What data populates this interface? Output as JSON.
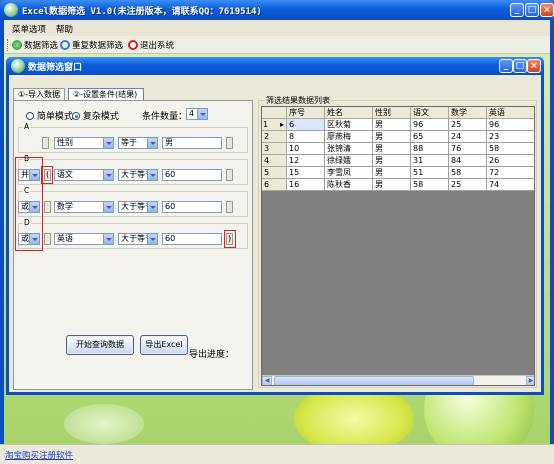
{
  "window": {
    "title": "Excel数据筛选 V1.0(未注册版本，请联系QQ：7619514)",
    "min": "_",
    "max": "□",
    "close": "×"
  },
  "menu": {
    "items": [
      "菜单选项",
      "帮助"
    ]
  },
  "toolbar": {
    "items": [
      "数据筛选",
      "重复数据筛选",
      "退出系统"
    ]
  },
  "inner": {
    "title": "数据筛选窗口",
    "min": "_",
    "max": "□",
    "close": "×"
  },
  "tabs": [
    "①-导入数据",
    "②-设置条件(结果)"
  ],
  "mode": {
    "simple": "简单模式",
    "complex": "复杂模式",
    "selected": "complex",
    "count_label": "条件数量：",
    "count_value": "4"
  },
  "conditions": [
    {
      "group": "A",
      "logic": "",
      "open_paren": "",
      "field": "性别",
      "op": "等于",
      "value": "男",
      "close_paren": ""
    },
    {
      "group": "B",
      "logic": "并",
      "open_paren": "(",
      "field": "语文",
      "op": "大于等于",
      "value": "60",
      "close_paren": ""
    },
    {
      "group": "C",
      "logic": "或",
      "open_paren": "",
      "field": "数学",
      "op": "大于等于",
      "value": "60",
      "close_paren": ""
    },
    {
      "group": "D",
      "logic": "或",
      "open_paren": "",
      "field": "英语",
      "op": "大于等于",
      "value": "60",
      "close_paren": ")"
    }
  ],
  "actions": {
    "query": "开始查询数据",
    "export": "导出Excel",
    "progress_label": "导出进度："
  },
  "results": {
    "label": "筛选结果数据列表",
    "columns": [
      "序号",
      "姓名",
      "性别",
      "语文",
      "数学",
      "英语"
    ],
    "rows": [
      [
        "1",
        "6",
        "区秋菊",
        "男",
        "96",
        "25",
        "96"
      ],
      [
        "2",
        "8",
        "廖燕梅",
        "男",
        "65",
        "24",
        "23"
      ],
      [
        "3",
        "10",
        "张锦清",
        "男",
        "88",
        "76",
        "58"
      ],
      [
        "4",
        "12",
        "徐绿娥",
        "男",
        "31",
        "84",
        "26"
      ],
      [
        "5",
        "15",
        "李雪凤",
        "男",
        "51",
        "58",
        "72"
      ],
      [
        "6",
        "16",
        "陈秋香",
        "男",
        "58",
        "25",
        "74"
      ]
    ]
  },
  "status": {
    "link": "淘宝购买注册软件"
  }
}
